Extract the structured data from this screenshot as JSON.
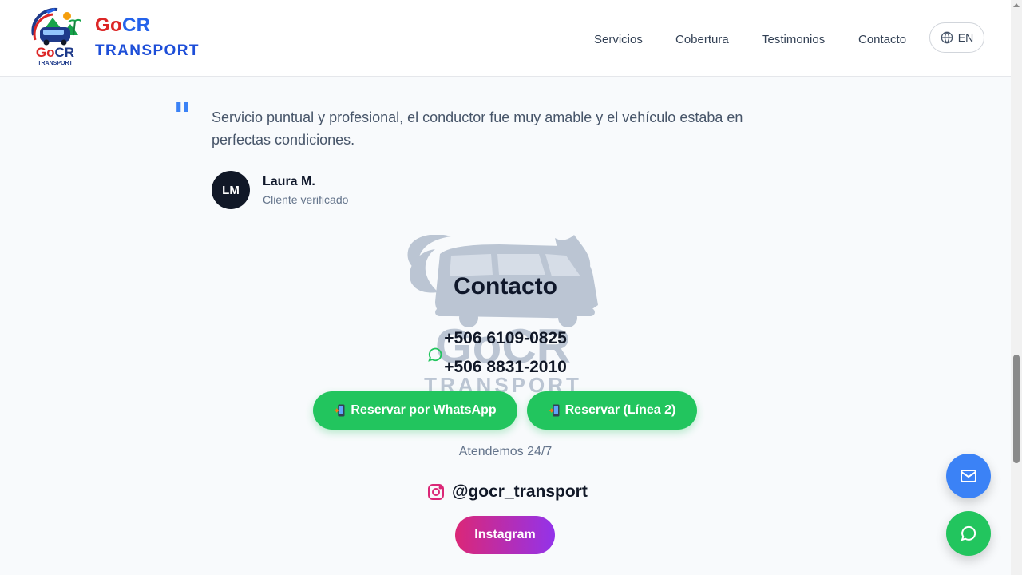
{
  "header": {
    "logo_text": "GoCR TRANSPORT",
    "brand_go": "Go",
    "brand_cr": "CR",
    "brand_sub": "TRANSPORT",
    "nav": {
      "servicios": "Servicios",
      "cobertura": "Cobertura",
      "testimonios": "Testimonios",
      "contacto": "Contacto"
    },
    "language": "EN"
  },
  "testimonial": {
    "quote": "Servicio puntual y profesional, el conductor fue muy amable y el vehículo estaba en perfectas condiciones.",
    "initials": "LM",
    "name": "Laura M.",
    "role": "Cliente verificado"
  },
  "contact": {
    "title": "Contacto",
    "watermark_text": "GoCR TRANSPORT",
    "phone1": "+506 6109-0825",
    "phone2": "+506 8831-2010",
    "btn_whatsapp": "Reservar por WhatsApp",
    "btn_line2": "Reservar (Línea 2)",
    "hours": "Atendemos 24/7",
    "instagram_handle": "@gocr_transport",
    "btn_instagram": "Instagram"
  },
  "colors": {
    "accent_blue": "#3b82f6",
    "whatsapp_green": "#22c55e",
    "brand_red": "#dc2626",
    "brand_blue": "#1d4ed8",
    "instagram_gradient": [
      "#db2777",
      "#9333ea"
    ]
  },
  "icons": [
    "globe-icon",
    "quote-icon",
    "whatsapp-icon",
    "mobile-phone-icon",
    "instagram-icon",
    "mail-icon",
    "chat-icon"
  ]
}
